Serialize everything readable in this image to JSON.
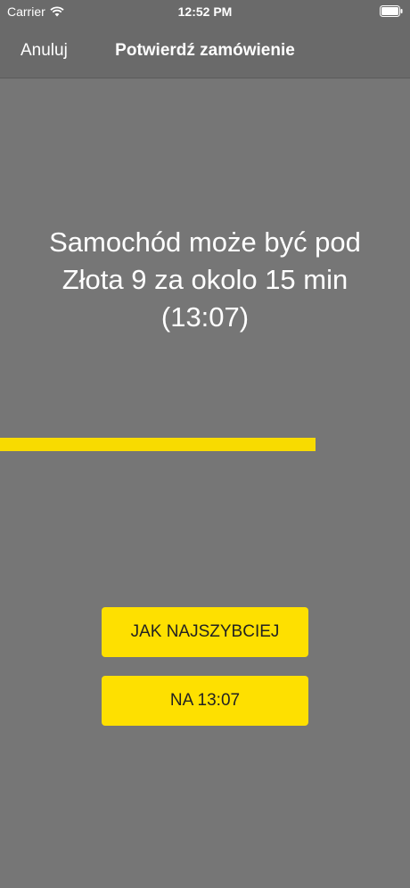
{
  "status_bar": {
    "carrier": "Carrier",
    "time": "12:52 PM",
    "icons": [
      "wifi-icon",
      "battery-icon"
    ]
  },
  "nav": {
    "cancel_label": "Anuluj",
    "title": "Potwierdź zamówienie"
  },
  "message": "Samochód może być pod Złota 9 za okolo 15 min (13:07)",
  "progress": {
    "fraction": 0.77,
    "color": "#f8db00"
  },
  "buttons": {
    "asap_label": "JAK NAJSZYBCIEJ",
    "scheduled_label": "NA 13:07"
  },
  "colors": {
    "background": "#767676",
    "nav_background": "#6a6a6a",
    "accent": "#fee000",
    "button_text": "#222222"
  }
}
